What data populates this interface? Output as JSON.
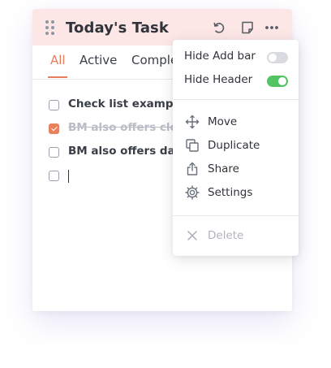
{
  "card": {
    "title": "Today's Task",
    "header_icons": [
      "drag-handle-icon",
      "refresh-icon",
      "note-icon",
      "more-icon"
    ],
    "header_color": "#fde6e6"
  },
  "tabs": [
    {
      "label": "All",
      "active": true
    },
    {
      "label": "Active",
      "active": false
    },
    {
      "label": "Comple",
      "active": false
    }
  ],
  "tasks": [
    {
      "text": "Check list example",
      "checked": false
    },
    {
      "text": "BM also offers clou",
      "checked": true
    },
    {
      "text": "BM also offers data",
      "checked": false
    },
    {
      "text": "",
      "checked": false,
      "editing": true
    }
  ],
  "menu": {
    "toggles": [
      {
        "label": "Hide Add bar",
        "on": false
      },
      {
        "label": "Hide Header",
        "on": true
      }
    ],
    "actions": [
      {
        "label": "Move",
        "icon": "move-icon"
      },
      {
        "label": "Duplicate",
        "icon": "duplicate-icon"
      },
      {
        "label": "Share",
        "icon": "share-icon"
      },
      {
        "label": "Settings",
        "icon": "gear-icon"
      }
    ],
    "danger": {
      "label": "Delete",
      "icon": "close-icon",
      "disabled": true
    }
  },
  "colors": {
    "accent": "#e67e5c",
    "toggle_on": "#53c464",
    "toggle_off": "#d9dbe0"
  }
}
